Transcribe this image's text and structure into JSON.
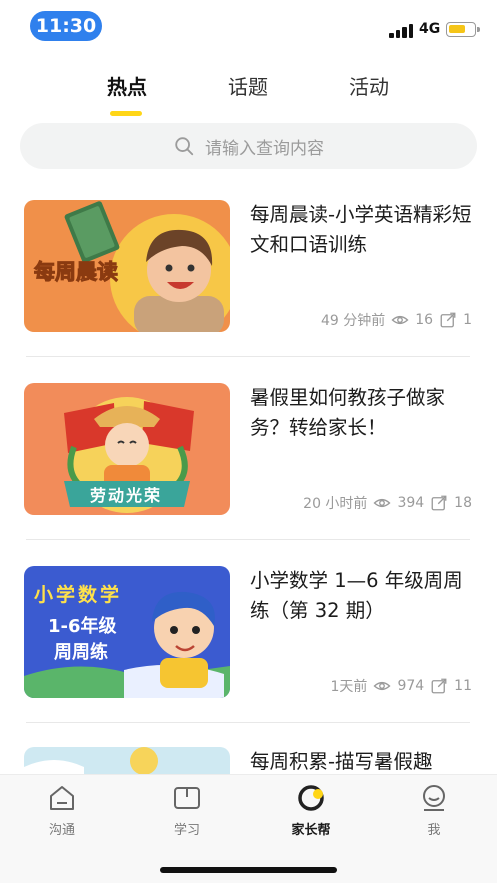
{
  "status_bar": {
    "time": "11:30",
    "network": "4G"
  },
  "tabs": [
    {
      "label": "热点",
      "active": true
    },
    {
      "label": "话题",
      "active": false
    },
    {
      "label": "活动",
      "active": false
    }
  ],
  "search": {
    "placeholder": "请输入查询内容"
  },
  "articles": [
    {
      "title": "每周晨读-小学英语精彩短文和口语训练",
      "thumb_text": "每周晨读",
      "time": "49 分钟前",
      "views": "16",
      "shares": "1"
    },
    {
      "title": "暑假里如何教孩子做家务？转给家长！",
      "thumb_text": "劳动光荣",
      "time": "20 小时前",
      "views": "394",
      "shares": "18"
    },
    {
      "title": "小学数学 1—6 年级周周练（第 32 期）",
      "thumb_text_1": "小学数学",
      "thumb_text_2": "1-6年级",
      "thumb_text_3": "周周练",
      "time": "1天前",
      "views": "974",
      "shares": "11"
    },
    {
      "title": "每周积累-描写暑假趣"
    }
  ],
  "bottom_nav": [
    {
      "label": "沟通",
      "icon": "chat-icon",
      "active": false
    },
    {
      "label": "学习",
      "icon": "book-icon",
      "active": false
    },
    {
      "label": "家长帮",
      "icon": "parent-help-icon",
      "active": true
    },
    {
      "label": "我",
      "icon": "profile-icon",
      "active": false
    }
  ],
  "colors": {
    "accent": "#ffd617",
    "time_pill": "#2f80ed",
    "card1": "#f0904a",
    "card2": "#f28c5a",
    "card3": "#3b5bd0"
  }
}
